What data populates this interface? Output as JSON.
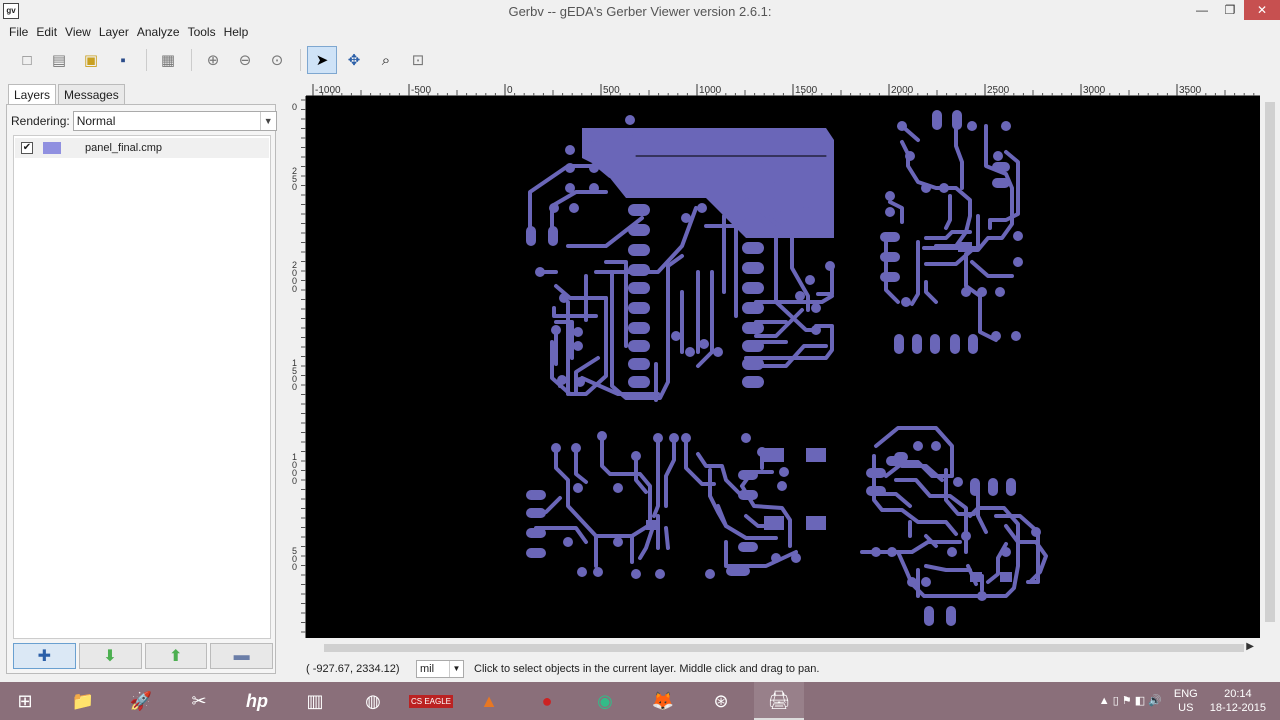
{
  "window": {
    "title": "Gerbv -- gEDA's Gerber Viewer version 2.6.1:",
    "app_icon_text": "gv",
    "min": "—",
    "max": "❐",
    "close": "✕"
  },
  "menu": [
    "File",
    "Edit",
    "View",
    "Layer",
    "Analyze",
    "Tools",
    "Help"
  ],
  "toolbar": {
    "new_icon": "□",
    "open_icon": "▤",
    "revert_icon": "▣",
    "save_icon": "▪",
    "print_icon": "▦",
    "zoom_in_icon": "⊕",
    "zoom_out_icon": "⊖",
    "zoom_fit_icon": "⊙",
    "pointer_icon": "➤",
    "pan_icon": "✥",
    "zoom_tool_icon": "⌕",
    "measure_icon": "⊡"
  },
  "sidebar": {
    "tabs": [
      "Layers",
      "Messages"
    ],
    "rendering_label": "Rendering:",
    "rendering_value": "Normal",
    "dropdown_arrow": "▼",
    "layers": [
      {
        "name": "panel_final.cmp",
        "visible": true,
        "color": "#9090e0",
        "check": "✔"
      }
    ],
    "buttons": {
      "add": "✚",
      "down": "⬇",
      "up": "⬆",
      "remove": "▬"
    }
  },
  "ruler": {
    "h_ticks": [
      "-1000",
      "-500",
      "0",
      "500",
      "1000",
      "1500",
      "2000",
      "2500",
      "3000",
      "3500"
    ],
    "v_labels": [
      "0",
      "2",
      "5",
      "0",
      "2",
      "0",
      "0",
      "0",
      "1",
      "5",
      "0",
      "0",
      "1",
      "0",
      "0",
      "0",
      "5",
      "0",
      "0"
    ]
  },
  "statusbar": {
    "coords": "( -927.67,  2334.12)",
    "unit": "mil",
    "unit_arrow": "▼",
    "message": "Click to select objects in the current layer. Middle click and drag to pan."
  },
  "scroll": {
    "right_arrow": "▶"
  },
  "taskbar": {
    "start_icon": "⊞",
    "apps": [
      "📁",
      "🚀",
      "✂",
      "hp",
      "▥",
      "◍",
      "CS EAGLE",
      "▲",
      "●",
      "◉",
      "🦊",
      "⊛",
      "🖨"
    ],
    "tray": {
      "lang": "ENG",
      "region": "US",
      "time": "20:14",
      "date": "18-12-2015",
      "icons": "▲ ▯ ⚑ ◧ 🔊"
    }
  },
  "colors": {
    "trace": "#6a66b8",
    "canvas": "#000000",
    "taskbar": "#8a6f7a"
  }
}
